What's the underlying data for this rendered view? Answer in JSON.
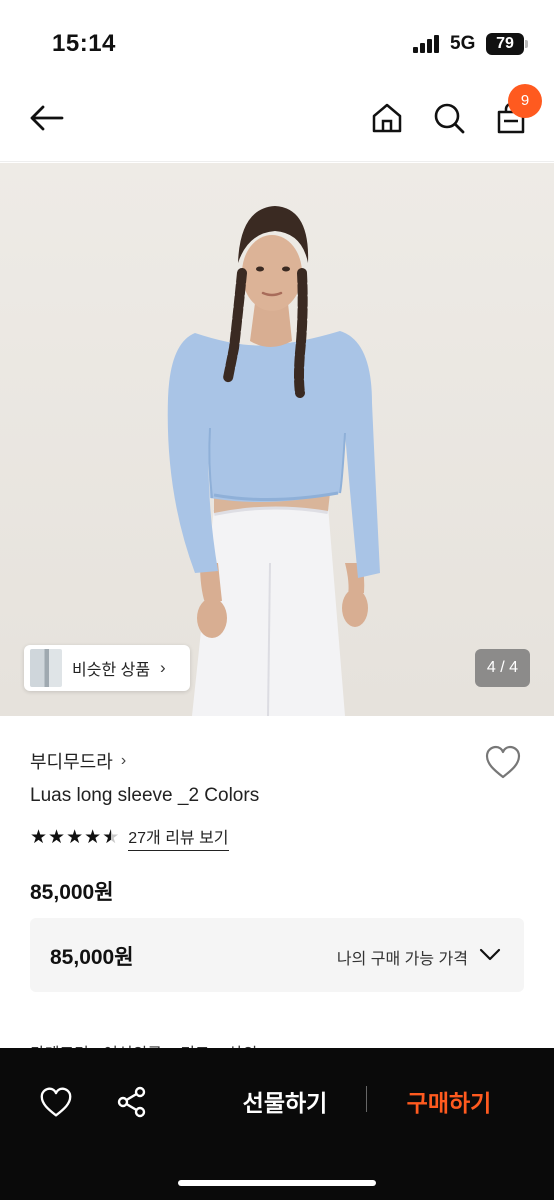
{
  "status": {
    "time": "15:14",
    "network": "5G",
    "battery": "79"
  },
  "nav": {
    "cart_count": "9"
  },
  "image": {
    "similar_label": "비슷한 상품",
    "counter": "4 / 4"
  },
  "product": {
    "brand": "부디무드라",
    "title": "Luas long sleeve _2 Colors",
    "rating": 4.5,
    "review_link": "27개 리뷰 보기",
    "price": "85,000원",
    "my_price": "85,000원",
    "my_price_label": "나의 구매 가능 가격",
    "category": "카테고리 · 여성의류 > 티드 > 상의"
  },
  "bottom_bar": {
    "gift_label": "선물하기",
    "buy_label": "구매하기"
  },
  "colors": {
    "accent": "#ff5a1f",
    "dark_bar": "#0a0a0a",
    "shirt": "#a9c4e6"
  },
  "icons": [
    "back-arrow-icon",
    "home-icon",
    "search-icon",
    "cart-icon",
    "heart-icon",
    "share-icon",
    "chevron-down-icon"
  ]
}
